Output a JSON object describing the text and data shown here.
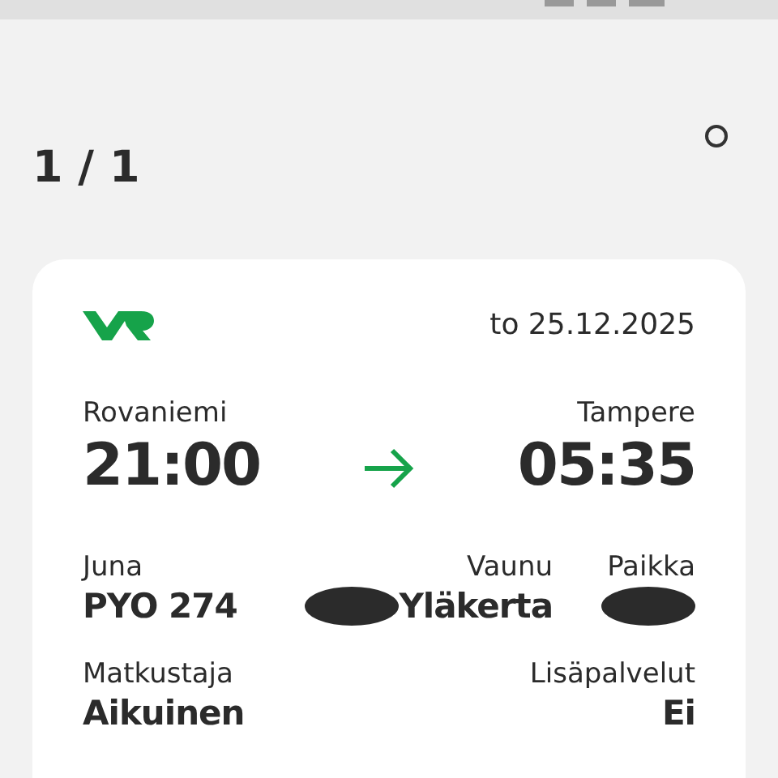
{
  "page_counter": "1 / 1",
  "ticket": {
    "date": "to 25.12.2025",
    "departure": {
      "station": "Rovaniemi",
      "time": "21:00"
    },
    "arrival": {
      "station": "Tampere",
      "time": "05:35"
    },
    "details": [
      {
        "label": "Juna",
        "value": "PYO 274"
      },
      {
        "label": "Vaunu",
        "value": "Yläkerta",
        "redacted": true
      },
      {
        "label": "Paikka",
        "redacted": true
      }
    ],
    "extra": [
      {
        "label": "Matkustaja",
        "value": "Aikuinen"
      },
      {
        "label": "Lisäpalvelut",
        "value": "Ei"
      }
    ]
  }
}
